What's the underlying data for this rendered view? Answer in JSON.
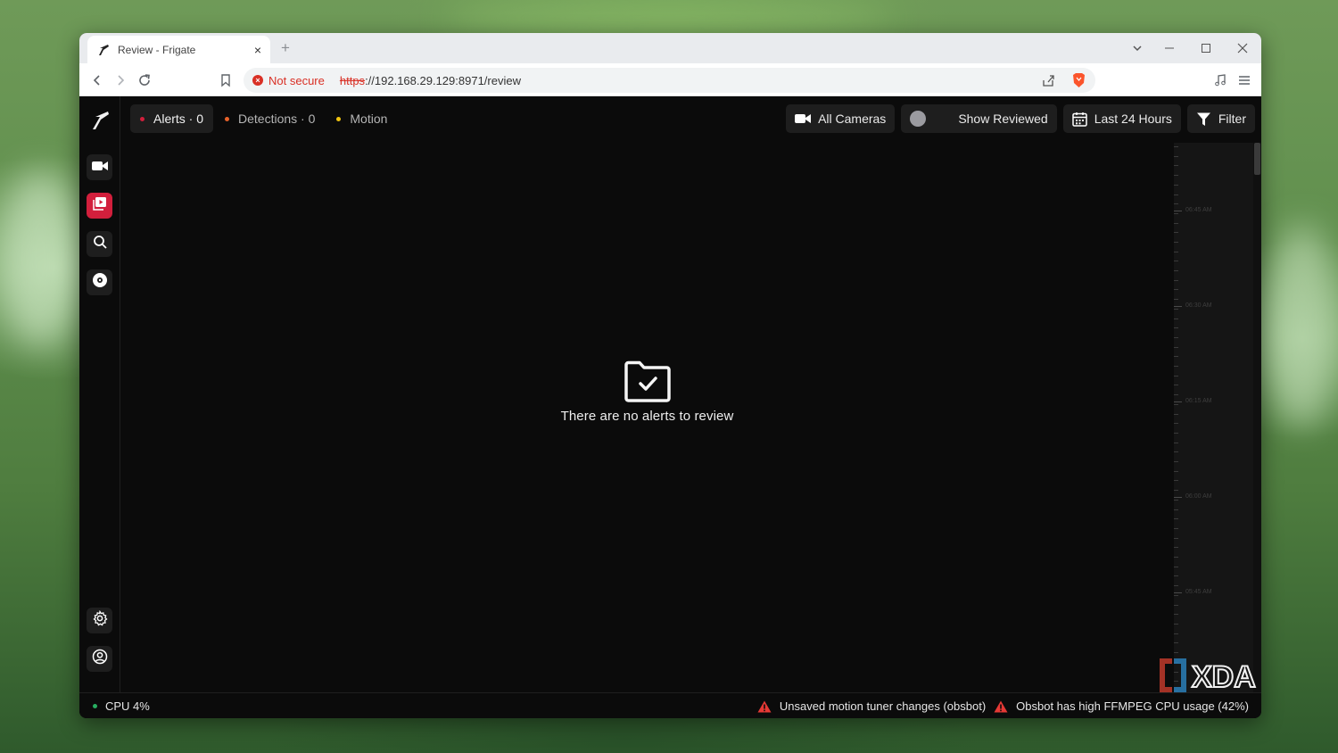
{
  "browser": {
    "tab_title": "Review - Frigate",
    "tab_close": "×",
    "new_tab": "+",
    "security_label": "Not secure",
    "url_scheme": "https",
    "url_rest": "://192.168.29.129:8971/review"
  },
  "app": {
    "nav_tabs": [
      {
        "label": "Alerts · 0",
        "dot_color": "#d21f3c"
      },
      {
        "label": "Detections · 0",
        "dot_color": "#e8622a"
      },
      {
        "label": "Motion",
        "dot_color": "#f1c40f"
      }
    ],
    "controls": {
      "cameras": "All Cameras",
      "show_reviewed": "Show Reviewed",
      "time_range": "Last 24 Hours",
      "filter": "Filter"
    },
    "empty_message": "There are no alerts to review",
    "timeline_labels": [
      "06:45 AM",
      "06:30 AM",
      "06:15 AM",
      "06:00 AM",
      "05:45 AM"
    ],
    "status": {
      "cpu": "CPU 4%",
      "warning_1": "Unsaved motion tuner changes (obsbot)",
      "warning_2": "Obsbot has high FFMPEG CPU usage (42%)"
    },
    "colors": {
      "accent": "#d21f3c",
      "background": "#0b0b0b",
      "cpu_ok": "#27ae60",
      "warning": "#e53935"
    }
  },
  "watermark": "XDA"
}
